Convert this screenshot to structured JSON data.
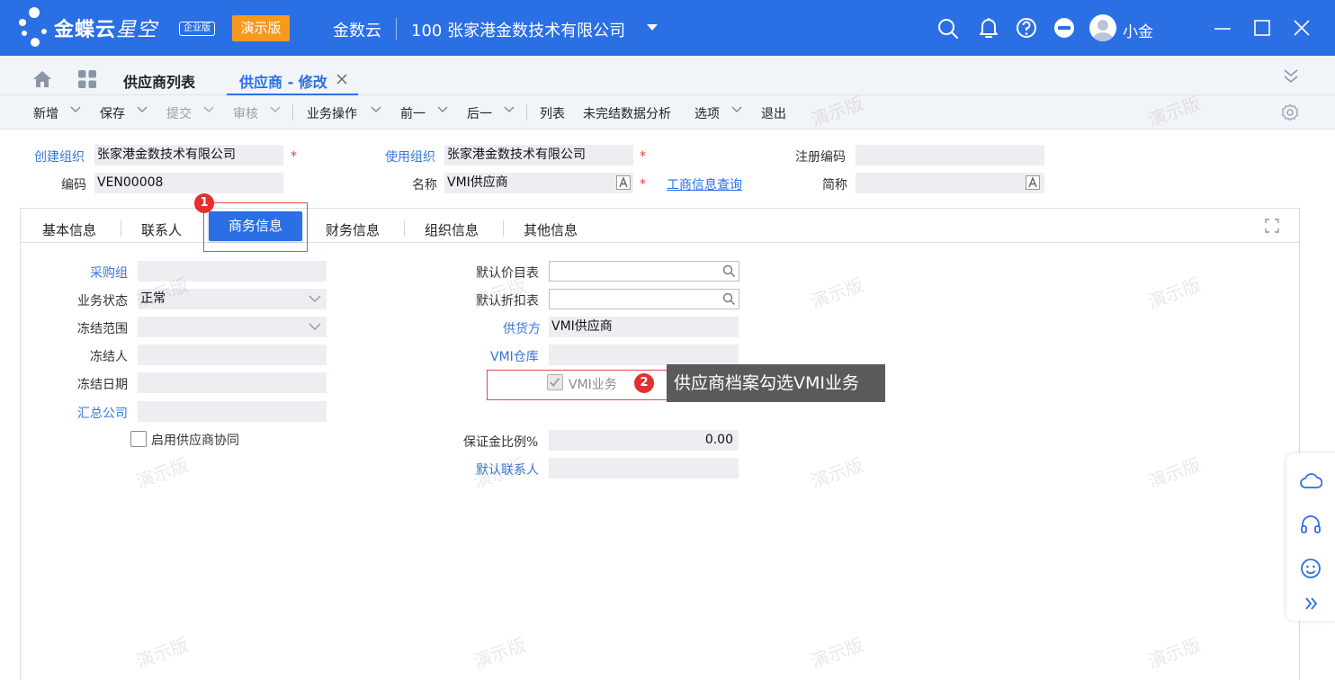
{
  "topbar": {
    "brand": "金蝶云",
    "brand_sub": "星空",
    "edition": "企业版",
    "demo_badge": "演示版",
    "product": "金数云",
    "company": "100  张家港金数技术有限公司",
    "username": "小金"
  },
  "tabs": {
    "list_tab": "供应商列表",
    "edit_tab": "供应商 - 修改"
  },
  "toolbar": {
    "new": "新增",
    "save": "保存",
    "submit": "提交",
    "audit": "审核",
    "biz_ops": "业务操作",
    "prev": "前一",
    "next": "后一",
    "list": "列表",
    "analysis": "未完结数据分析",
    "options": "选项",
    "exit": "退出"
  },
  "header": {
    "create_org_label": "创建组织",
    "create_org_value": "张家港金数技术有限公司",
    "use_org_label": "使用组织",
    "use_org_value": "张家港金数技术有限公司",
    "reg_code_label": "注册编码",
    "reg_code_value": "",
    "code_label": "编码",
    "code_value": "VEN00008",
    "name_label": "名称",
    "name_value": "VMI供应商",
    "biz_query_link": "工商信息查询",
    "short_name_label": "简称",
    "short_name_value": ""
  },
  "inner_tabs": [
    "基本信息",
    "联系人",
    "商务信息",
    "财务信息",
    "组织信息",
    "其他信息"
  ],
  "form": {
    "purchase_group_label": "采购组",
    "purchase_group_value": "",
    "biz_status_label": "业务状态",
    "biz_status_value": "正常",
    "freeze_scope_label": "冻结范围",
    "freeze_scope_value": "",
    "freezer_label": "冻结人",
    "freezer_value": "",
    "freeze_date_label": "冻结日期",
    "freeze_date_value": "",
    "summary_company_label": "汇总公司",
    "summary_company_value": "",
    "enable_collab_label": "启用供应商协同",
    "default_price_label": "默认价目表",
    "default_price_value": "",
    "default_discount_label": "默认折扣表",
    "default_discount_value": "",
    "supplier_label": "供货方",
    "supplier_value": "VMI供应商",
    "vmi_warehouse_label": "VMI仓库",
    "vmi_warehouse_value": "",
    "vmi_business_label": "VMI业务",
    "deposit_ratio_label": "保证金比例%",
    "deposit_ratio_value": "0.00",
    "default_contact_label": "默认联系人",
    "default_contact_value": ""
  },
  "annotations": {
    "step1": "1",
    "step2": "2",
    "tooltip": "供应商档案勾选VMI业务"
  },
  "watermark": "演示版",
  "colors": {
    "brand_blue": "#2b6fe5",
    "demo_orange": "#f79a1b",
    "required_red": "#e53b3b",
    "annotation_red": "#e22f2f"
  }
}
